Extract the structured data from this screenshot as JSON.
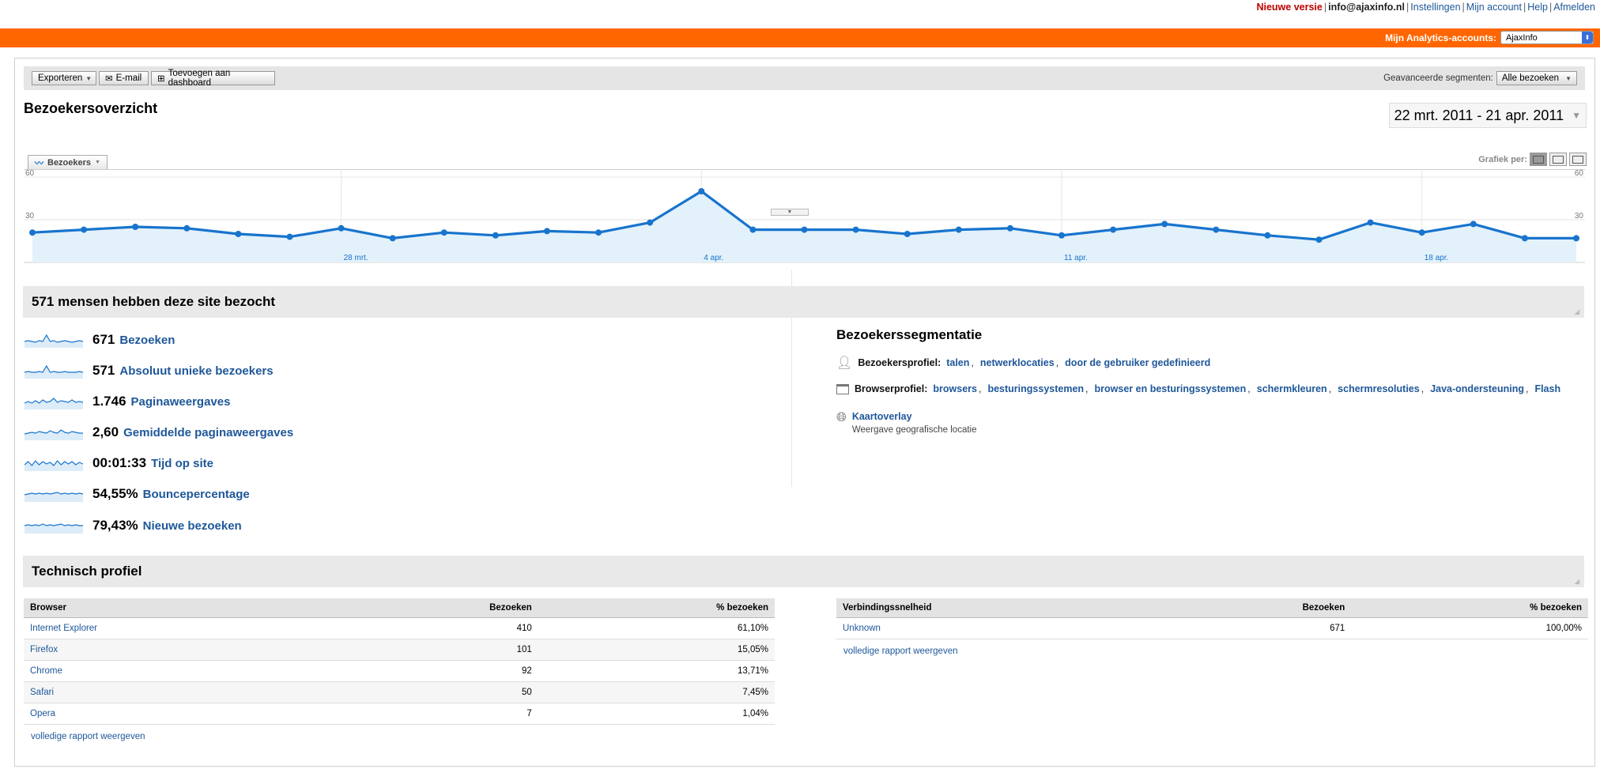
{
  "topbar": {
    "new_version": "Nieuwe versie",
    "email": "info@ajaxinfo.nl",
    "links": [
      "Instellingen",
      "Mijn account",
      "Help",
      "Afmelden"
    ]
  },
  "accounts": {
    "label": "Mijn Analytics-accounts:",
    "selected": "AjaxInfo"
  },
  "toolbar": {
    "export": "Exporteren",
    "email": "E-mail",
    "add_dashboard": "Toevoegen aan dashboard",
    "segments_label": "Geavanceerde segmenten:",
    "segments_value": "Alle bezoeken"
  },
  "page_title": "Bezoekersoverzicht",
  "date_range": "22 mrt. 2011 - 21 apr. 2011",
  "chart_tab": "Bezoekers",
  "grafiek_label": "Grafiek per:",
  "chart_data": {
    "type": "area",
    "series": [
      {
        "name": "Bezoekers",
        "values": [
          21,
          23,
          25,
          24,
          20,
          18,
          24,
          17,
          21,
          19,
          22,
          21,
          28,
          50,
          23,
          23,
          23,
          20,
          23,
          24,
          19,
          23,
          27,
          23,
          19,
          16,
          28,
          21,
          27,
          17,
          17
        ]
      }
    ],
    "x_tick_labels": [
      "28 mrt.",
      "4 apr.",
      "11 apr.",
      "18 apr."
    ],
    "x_tick_index": [
      6,
      13,
      20,
      27
    ],
    "y_ticks": [
      "60",
      "30"
    ],
    "ylim": [
      0,
      60
    ],
    "grid": true
  },
  "summary_title": "571 mensen hebben deze site bezocht",
  "metrics": [
    {
      "value": "671",
      "label": "Bezoeken"
    },
    {
      "value": "571",
      "label": "Absoluut unieke bezoekers"
    },
    {
      "value": "1.746",
      "label": "Paginaweergaves"
    },
    {
      "value": "2,60",
      "label": "Gemiddelde paginaweergaves"
    },
    {
      "value": "00:01:33",
      "label": "Tijd op site"
    },
    {
      "value": "54,55%",
      "label": "Bouncepercentage"
    },
    {
      "value": "79,43%",
      "label": "Nieuwe bezoeken"
    }
  ],
  "segmentation": {
    "title": "Bezoekerssegmentatie",
    "visitor_profile_label": "Bezoekersprofiel:",
    "visitor_profile_links": [
      "talen",
      "netwerklocaties",
      "door de gebruiker gedefinieerd"
    ],
    "browser_profile_label": "Browserprofiel:",
    "browser_profile_links": [
      "browsers",
      "besturingssystemen",
      "browser en besturingssystemen",
      "schermkleuren",
      "schermresoluties",
      "Java-ondersteuning",
      "Flash"
    ],
    "map_overlay": "Kaartoverlay",
    "map_overlay_sub": "Weergave geografische locatie"
  },
  "tech_title": "Technisch profiel",
  "browser_table": {
    "headers": [
      "Browser",
      "Bezoeken",
      "% bezoeken"
    ],
    "rows": [
      [
        "Internet Explorer",
        "410",
        "61,10%"
      ],
      [
        "Firefox",
        "101",
        "15,05%"
      ],
      [
        "Chrome",
        "92",
        "13,71%"
      ],
      [
        "Safari",
        "50",
        "7,45%"
      ],
      [
        "Opera",
        "7",
        "1,04%"
      ]
    ],
    "full_report": "volledige rapport weergeven"
  },
  "connection_table": {
    "headers": [
      "Verbindingssnelheid",
      "Bezoeken",
      "% bezoeken"
    ],
    "rows": [
      [
        "Unknown",
        "671",
        "100,00%"
      ]
    ],
    "full_report": "volledige rapport weergeven"
  },
  "colors": {
    "orange": "#ff6600",
    "line": "#1874cd",
    "area": "#e3f1fb",
    "link": "#1e5799"
  }
}
